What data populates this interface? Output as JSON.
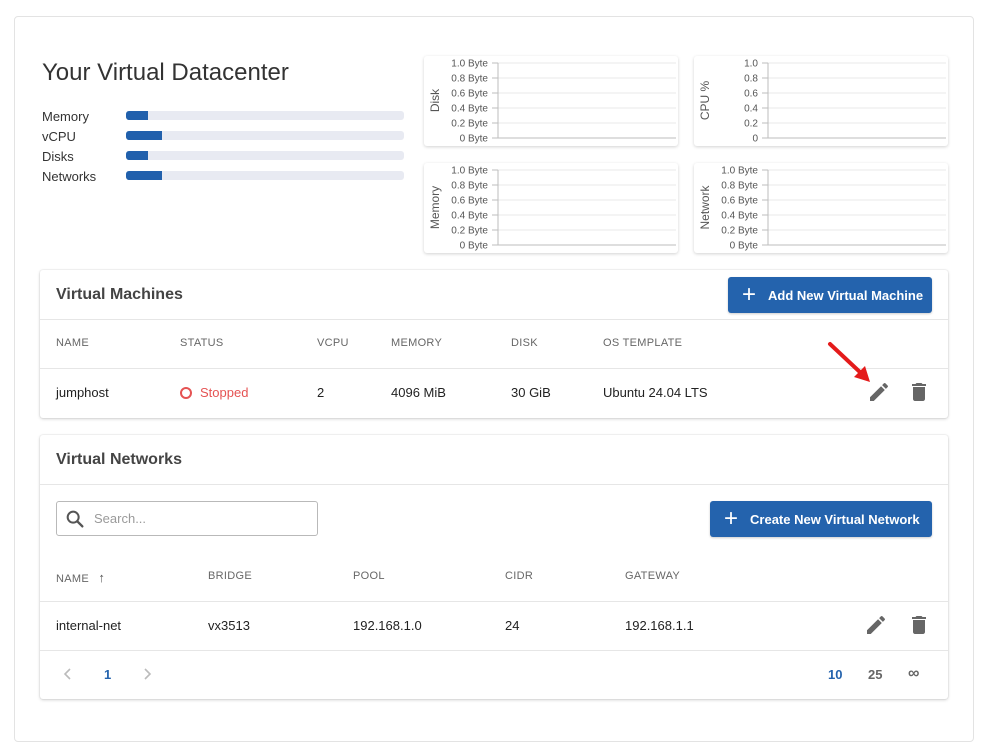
{
  "datacenter": {
    "title": "Your Virtual Datacenter",
    "resources": [
      {
        "label": "Memory",
        "fill_percent": 8
      },
      {
        "label": "vCPU",
        "fill_percent": 13
      },
      {
        "label": "Disks",
        "fill_percent": 8
      },
      {
        "label": "Networks",
        "fill_percent": 13
      }
    ]
  },
  "charts": [
    {
      "id": "disk",
      "ylabel": "Disk",
      "ticks": [
        "1.0 Byte",
        "0.8 Byte",
        "0.6 Byte",
        "0.4 Byte",
        "0.2 Byte",
        "0 Byte"
      ]
    },
    {
      "id": "cpu",
      "ylabel": "CPU %",
      "ticks": [
        "1.0",
        "0.8",
        "0.6",
        "0.4",
        "0.2",
        "0"
      ]
    },
    {
      "id": "memory",
      "ylabel": "Memory",
      "ticks": [
        "1.0 Byte",
        "0.8 Byte",
        "0.6 Byte",
        "0.4 Byte",
        "0.2 Byte",
        "0 Byte"
      ]
    },
    {
      "id": "network",
      "ylabel": "Network",
      "ticks": [
        "1.0 Byte",
        "0.8 Byte",
        "0.6 Byte",
        "0.4 Byte",
        "0.2 Byte",
        "0 Byte"
      ]
    }
  ],
  "vms": {
    "title": "Virtual Machines",
    "add_button": "Add New Virtual Machine",
    "columns": [
      "NAME",
      "STATUS",
      "VCPU",
      "MEMORY",
      "DISK",
      "OS TEMPLATE"
    ],
    "rows": [
      {
        "name": "jumphost",
        "status": "Stopped",
        "vcpu": "2",
        "memory": "4096 MiB",
        "disk": "30 GiB",
        "os_template": "Ubuntu 24.04 LTS"
      }
    ]
  },
  "networks": {
    "title": "Virtual Networks",
    "search_placeholder": "Search...",
    "create_button": "Create New Virtual Network",
    "columns": [
      "NAME",
      "BRIDGE",
      "POOL",
      "CIDR",
      "GATEWAY"
    ],
    "sort_indicator": "↑",
    "rows": [
      {
        "name": "internal-net",
        "bridge": "vx3513",
        "pool": "192.168.1.0",
        "cidr": "24",
        "gateway": "192.168.1.1"
      }
    ],
    "pagination": {
      "current_page": "1",
      "page_sizes": [
        "10",
        "25",
        "∞"
      ],
      "selected_page_size": "10"
    }
  },
  "colors": {
    "primary": "#2463ad",
    "bar_fill": "#2160ac",
    "bar_track": "#e8eaf2",
    "stopped": "#e55353",
    "annotation_arrow": "#e41b1b",
    "icon_gray": "#666666"
  }
}
